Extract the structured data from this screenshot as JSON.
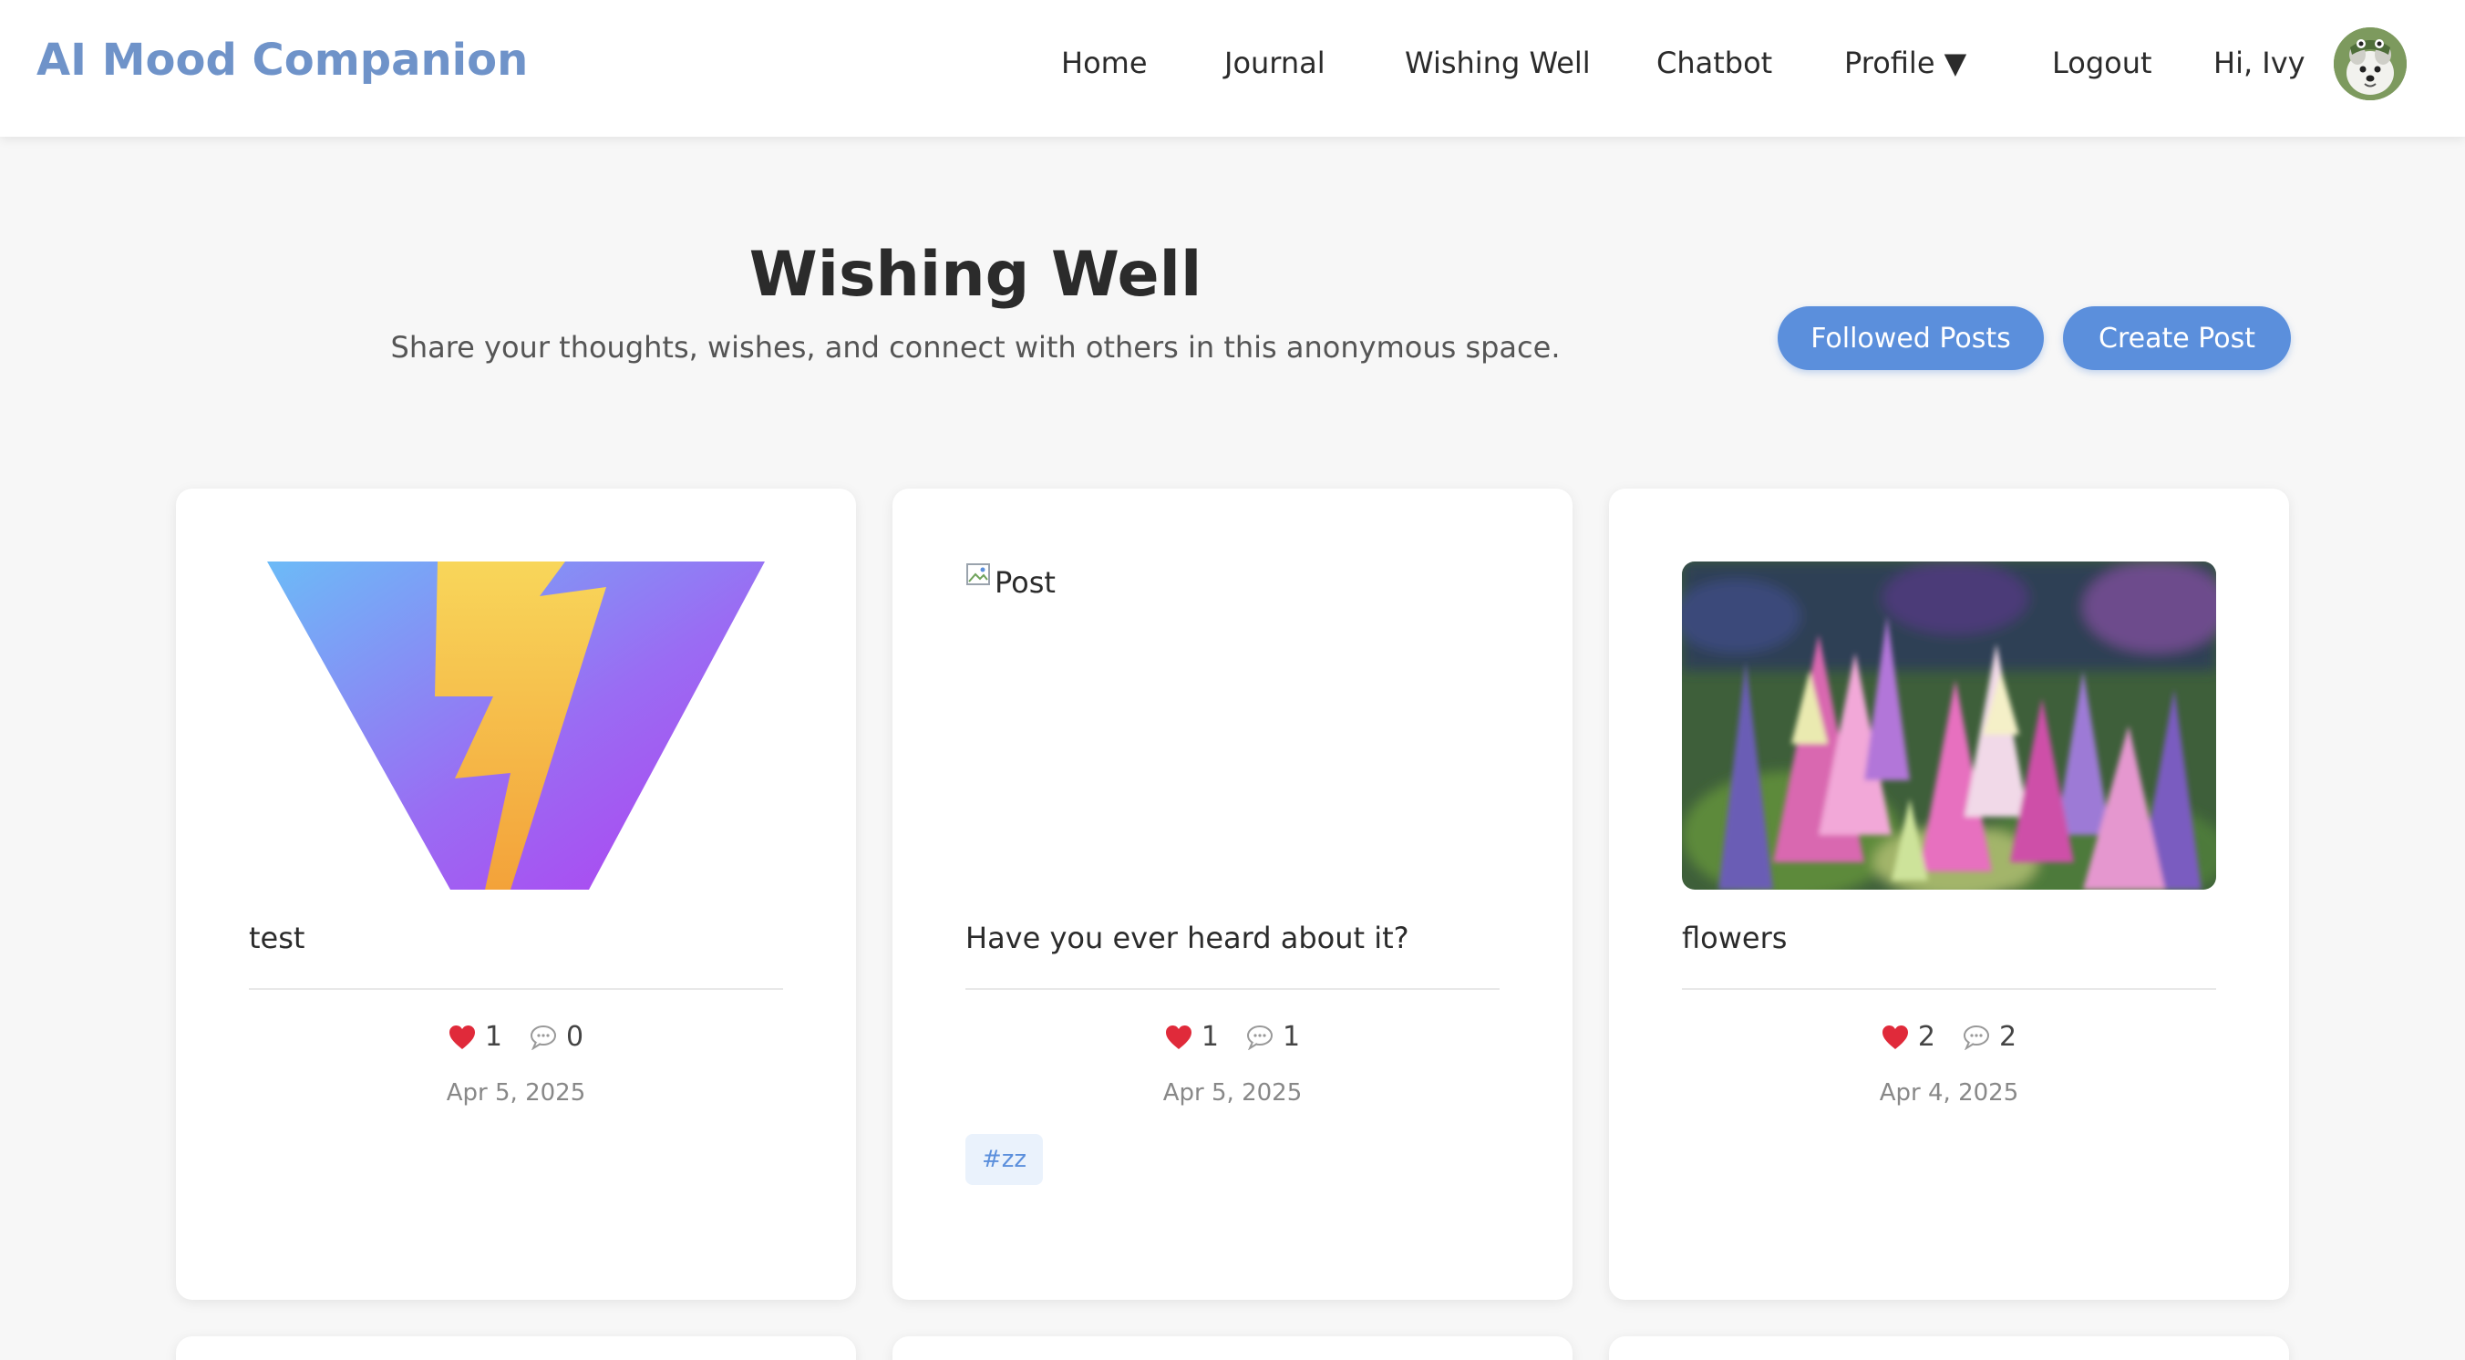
{
  "nav": {
    "brand": "AI Mood Companion",
    "links": [
      "Home",
      "Journal",
      "Wishing Well",
      "Chatbot",
      "Profile ▼",
      "Logout"
    ],
    "greeting": "Hi, Ivy"
  },
  "hero": {
    "title": "Wishing Well",
    "subtitle": "Share your thoughts, wishes, and connect with others in this anonymous space.",
    "followed_label": "Followed Posts",
    "create_label": "Create Post"
  },
  "posts": [
    {
      "text": "test",
      "likes": "1",
      "comments": "0",
      "date": "Apr 5, 2025",
      "image": "lightning-logo"
    },
    {
      "text": "Have you ever heard about it?",
      "likes": "1",
      "comments": "1",
      "date": "Apr 5, 2025",
      "image_alt": "Post",
      "tag": "#zz"
    },
    {
      "text": "flowers",
      "likes": "2",
      "comments": "2",
      "date": "Apr 4, 2025",
      "image": "lupine-flowers-photo"
    }
  ],
  "colors": {
    "brand": "#6f93c9",
    "accent": "#5b8fdc",
    "background": "#f7f7f7"
  }
}
